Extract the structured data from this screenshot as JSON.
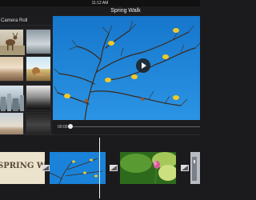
{
  "status_bar": {
    "time": "11:12 AM"
  },
  "project": {
    "title": "Spring Walk"
  },
  "browser": {
    "title": "Camera Roll"
  },
  "scrubber": {
    "current_time": "00:00",
    "progress": 0.0
  },
  "timeline": {
    "title_clip_text": "SPRING WALK"
  },
  "icons": {
    "play": "play-icon",
    "transition": "cross-dissolve-icon"
  },
  "colors": {
    "sky": "#1a82d8",
    "background": "#1b1b1d"
  }
}
